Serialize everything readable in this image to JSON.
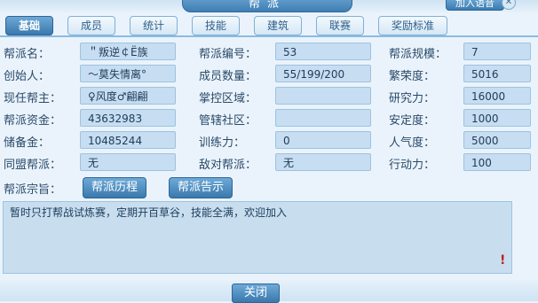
{
  "window": {
    "title": "帮派",
    "join_voice_label": "加入语音",
    "close_label": "✕"
  },
  "tabs": [
    {
      "label": "基础"
    },
    {
      "label": "成员"
    },
    {
      "label": "统计"
    },
    {
      "label": "技能"
    },
    {
      "label": "建筑"
    },
    {
      "label": "联赛"
    },
    {
      "label": "奖励标准"
    }
  ],
  "active_tab": "基础",
  "info": {
    "col1": [
      {
        "label": "帮派名：",
        "value": "＂叛逆￠Ë族"
      },
      {
        "label": "创始人：",
        "value": "～莫失情离°"
      },
      {
        "label": "现任帮主：",
        "value": "♀风度♂翩翩"
      },
      {
        "label": "帮派资金：",
        "value": "43632983"
      },
      {
        "label": "储备金：",
        "value": "10485244"
      },
      {
        "label": "同盟帮派：",
        "value": "无"
      }
    ],
    "col2": [
      {
        "label": "帮派编号：",
        "value": "53"
      },
      {
        "label": "成员数量：",
        "value": "55/199/200"
      },
      {
        "label": "掌控区域：",
        "value": ""
      },
      {
        "label": "管辖社区：",
        "value": ""
      },
      {
        "label": "训练力：",
        "value": "0"
      },
      {
        "label": "敌对帮派：",
        "value": "无"
      }
    ],
    "col3": [
      {
        "label": "帮派规模：",
        "value": "7"
      },
      {
        "label": "繁荣度：",
        "value": "5016"
      },
      {
        "label": "研究力：",
        "value": "16000"
      },
      {
        "label": "安定度：",
        "value": "1000"
      },
      {
        "label": "人气度：",
        "value": "5000"
      },
      {
        "label": "行动力：",
        "value": "100"
      }
    ]
  },
  "motto": {
    "label": "帮派宗旨：",
    "history_button": "帮派历程",
    "notice_button": "帮派告示",
    "text": "暂时只打帮战试炼赛，定期开百草谷，技能全满，欢迎加入",
    "warning_mark": "!"
  },
  "footer": {
    "close_button": "关闭"
  }
}
